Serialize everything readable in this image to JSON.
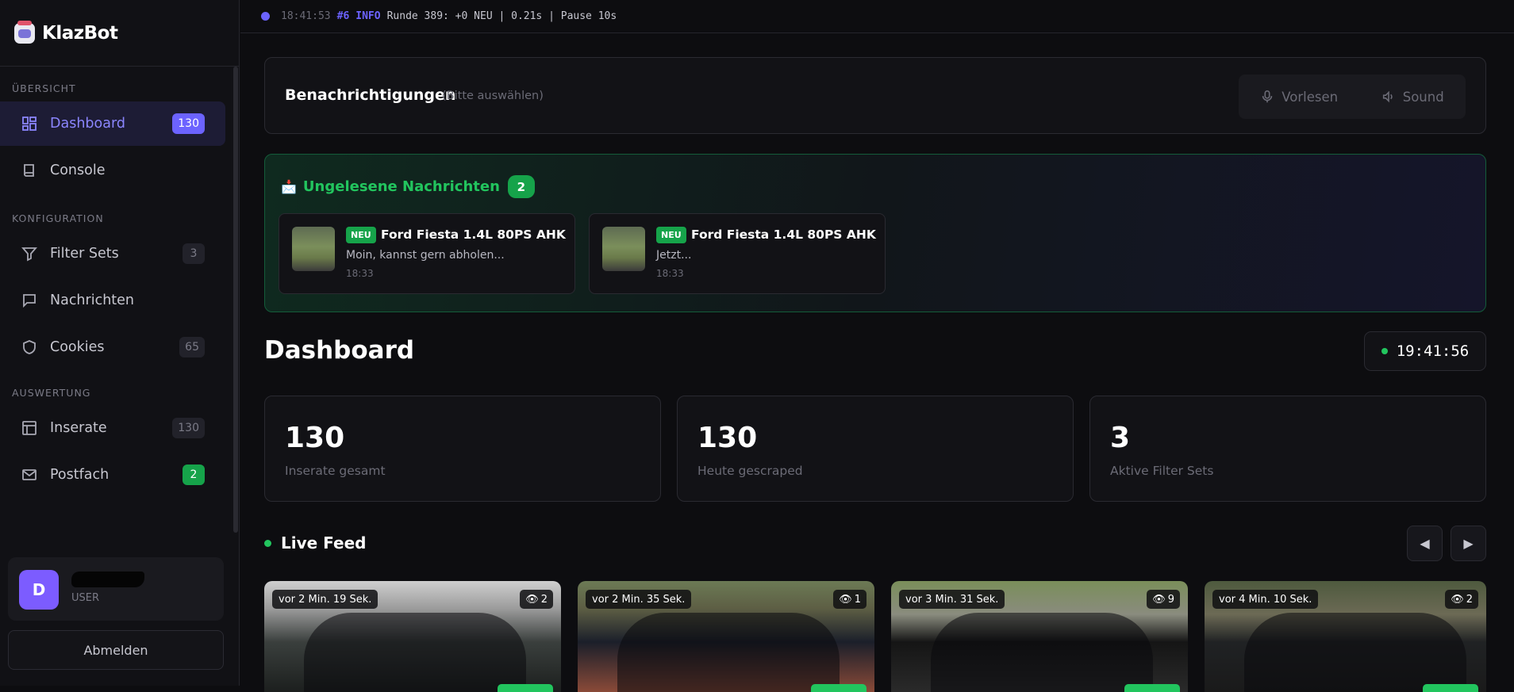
{
  "app": {
    "name": "KlazBot"
  },
  "topbar": {
    "time": "18:41:53",
    "num": "#6",
    "level": "INFO",
    "message": "Runde 389: +0 NEU | 0.21s | Pause 10s"
  },
  "sidebar": {
    "sections": [
      {
        "label": "ÜBERSICHT"
      },
      {
        "label": "KONFIGURATION"
      },
      {
        "label": "AUSWERTUNG"
      }
    ],
    "items": [
      {
        "label": "Dashboard",
        "count": "130",
        "icon": "grid-icon"
      },
      {
        "label": "Console",
        "count": "",
        "icon": "book-icon"
      },
      {
        "label": "Filter Sets",
        "count": "3",
        "icon": "filter-icon"
      },
      {
        "label": "Nachrichten",
        "count": "",
        "icon": "chat-icon"
      },
      {
        "label": "Cookies",
        "count": "65",
        "icon": "shield-icon"
      },
      {
        "label": "Inserate",
        "count": "130",
        "icon": "layout-icon"
      },
      {
        "label": "Postfach",
        "count": "2",
        "icon": "mail-icon"
      }
    ]
  },
  "user": {
    "initial": "D",
    "role": "USER",
    "logout": "Abmelden"
  },
  "notifications": {
    "title": "Benachrichtigungen",
    "subtitle": "(Bitte auswählen)",
    "read_aloud": "Vorlesen",
    "sound": "Sound"
  },
  "unread": {
    "title": "Ungelesene Nachrichten",
    "count": "2",
    "messages": [
      {
        "tag": "NEU",
        "title": "Ford Fiesta 1.4L 80PS AHK",
        "preview": "Moin, kannst gern abholen...",
        "time": "18:33"
      },
      {
        "tag": "NEU",
        "title": "Ford Fiesta 1.4L 80PS AHK",
        "preview": "Jetzt...",
        "time": "18:33"
      }
    ]
  },
  "dashboard": {
    "title": "Dashboard",
    "clock": "19:41:56"
  },
  "stats": [
    {
      "value": "130",
      "label": "Inserate gesamt"
    },
    {
      "value": "130",
      "label": "Heute gescraped"
    },
    {
      "value": "3",
      "label": "Aktive Filter Sets"
    }
  ],
  "live_feed": {
    "title": "Live Feed",
    "prev": "◀",
    "next": "▶",
    "items": [
      {
        "age": "vor 2 Min. 19 Sek.",
        "views": "2"
      },
      {
        "age": "vor 2 Min. 35 Sek.",
        "views": "1"
      },
      {
        "age": "vor 3 Min. 31 Sek.",
        "views": "9"
      },
      {
        "age": "vor 4 Min. 10 Sek.",
        "views": "2"
      }
    ]
  }
}
